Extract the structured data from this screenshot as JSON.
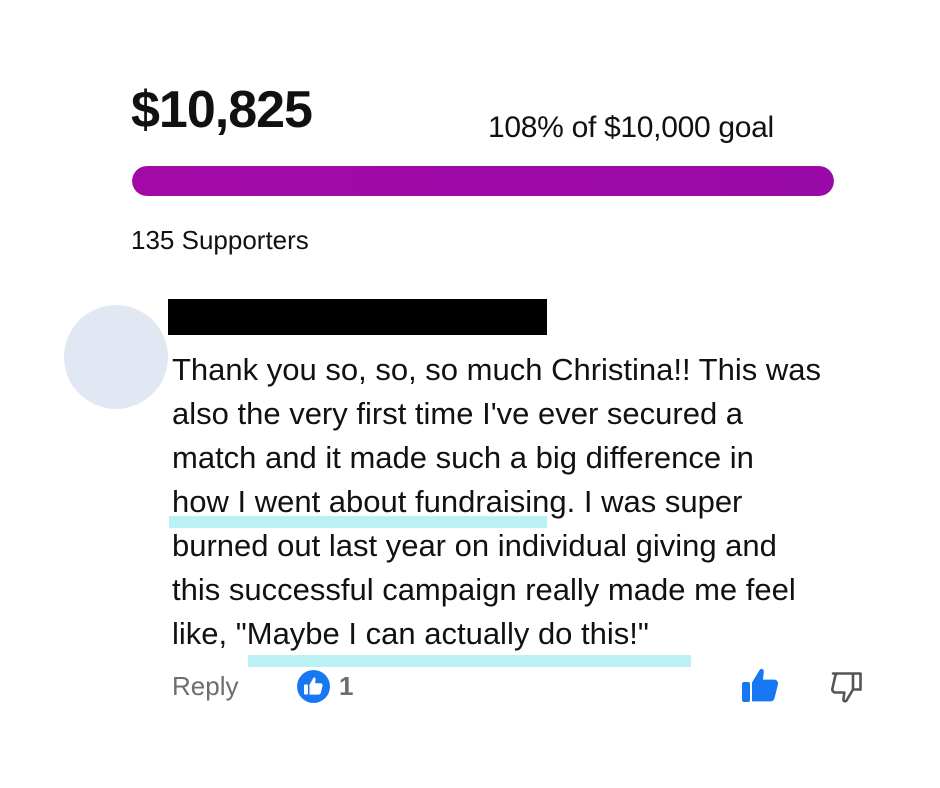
{
  "campaign": {
    "amount_raised": "$10,825",
    "goal_text": "108% of $10,000 goal",
    "progress_fraction": 1.0,
    "supporters_text": "135 Supporters",
    "progress_color": "#a20aa6"
  },
  "comment": {
    "author_redacted": true,
    "text_lines": [
      "Thank you so, so, so much Christina!! This was",
      "also the very first time I've ever secured a",
      "match and it made such a big difference in",
      "how I went about fundraising. I was super",
      "burned out last year on individual giving and",
      "this successful campaign really made me feel",
      "like, \"Maybe I can actually do this!\""
    ],
    "reply_label": "Reply",
    "like_count": "1",
    "highlight_color": "#b9f1f4",
    "like_color": "#1877f2"
  },
  "icons": {
    "like_badge": "thumbs-up-badge-icon",
    "like_action": "thumbs-up-icon",
    "dislike_action": "thumbs-down-icon"
  }
}
